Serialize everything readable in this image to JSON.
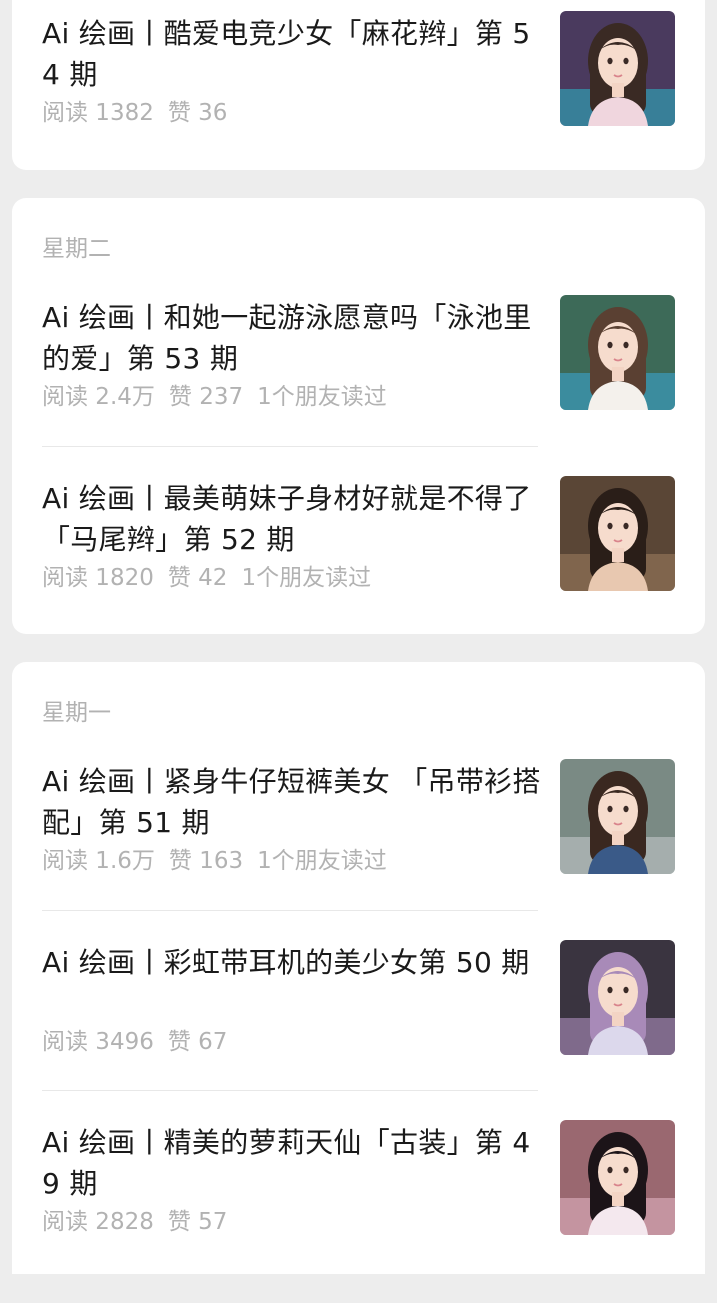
{
  "articles": [
    {
      "title": "Ai 绘画丨酷爱电竞少女「麻花辫」第 54 期",
      "reads": "阅读 1382",
      "likes": "赞 36",
      "friends": ""
    },
    {
      "title": "Ai 绘画丨和她一起游泳愿意吗「泳池里的爱」第 53 期",
      "reads": "阅读 2.4万",
      "likes": "赞 237",
      "friends": "1个朋友读过"
    },
    {
      "title": "Ai 绘画丨最美萌妹子身材好就是不得了「马尾辫」第 52 期",
      "reads": "阅读 1820",
      "likes": "赞 42",
      "friends": "1个朋友读过"
    },
    {
      "title": "Ai 绘画丨紧身牛仔短裤美女 「吊带衫搭配」第 51 期",
      "reads": "阅读 1.6万",
      "likes": "赞 163",
      "friends": "1个朋友读过"
    },
    {
      "title": "Ai 绘画丨彩虹带耳机的美少女第 50 期",
      "reads": "阅读 3496",
      "likes": "赞 67",
      "friends": ""
    },
    {
      "title": "Ai 绘画丨精美的萝莉天仙「古装」第 49 期",
      "reads": "阅读 2828",
      "likes": "赞 57",
      "friends": ""
    }
  ],
  "days": {
    "tuesday": "星期二",
    "monday": "星期一"
  },
  "thumbnails": [
    {
      "bg": "#4a3a5e",
      "accent": "#2ab8c8",
      "hair": "#3a2a24",
      "top": "#f0d6de"
    },
    {
      "bg": "#3d6a58",
      "accent": "#3aa8d8",
      "hair": "#5a4032",
      "top": "#f4f1ec"
    },
    {
      "bg": "#5a4636",
      "accent": "#a08060",
      "hair": "#2a1e18",
      "top": "#e8c8b0"
    },
    {
      "bg": "#7a8a84",
      "accent": "#c8ccd0",
      "hair": "#3a2820",
      "top": "#3a5a88"
    },
    {
      "bg": "#3a3440",
      "accent": "#b898c8",
      "hair": "#a88ab8",
      "top": "#dcd8ec"
    },
    {
      "bg": "#9a6870",
      "accent": "#e8b8c8",
      "hair": "#1c1418",
      "top": "#f4e8ee"
    }
  ]
}
